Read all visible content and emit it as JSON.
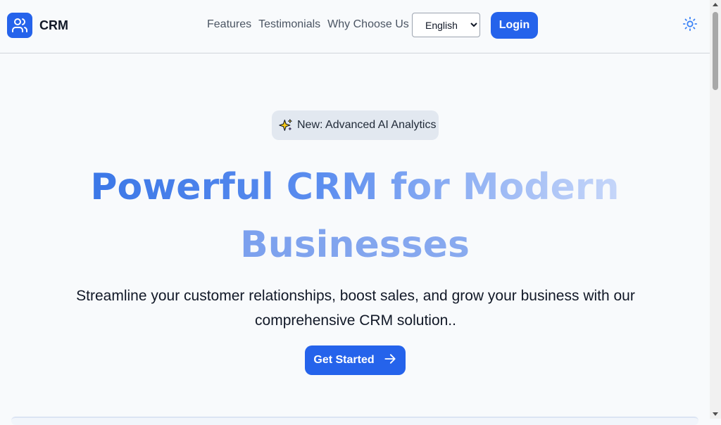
{
  "brand": {
    "name": "CRM",
    "icon": "users-icon",
    "color": "#2563eb"
  },
  "nav": {
    "links": [
      {
        "label": "Features"
      },
      {
        "label": "Testimonials"
      },
      {
        "label": "Why Choose Us"
      }
    ],
    "language": {
      "selected": "English"
    },
    "login_label": "Login",
    "theme_icon": "sun-icon"
  },
  "hero": {
    "badge": {
      "icon": "sparkles-icon",
      "text": "New: Advanced AI Analytics"
    },
    "title_line1": "Powerful CRM for Modern",
    "title_line2": "Businesses",
    "subtitle": "Streamline your customer relationships, boost sales, and grow your business with our comprehensive CRM solution..",
    "cta_label": "Get Started",
    "cta_icon": "arrow-right-icon"
  },
  "colors": {
    "accent": "#2563eb",
    "background": "#f8fafc"
  }
}
